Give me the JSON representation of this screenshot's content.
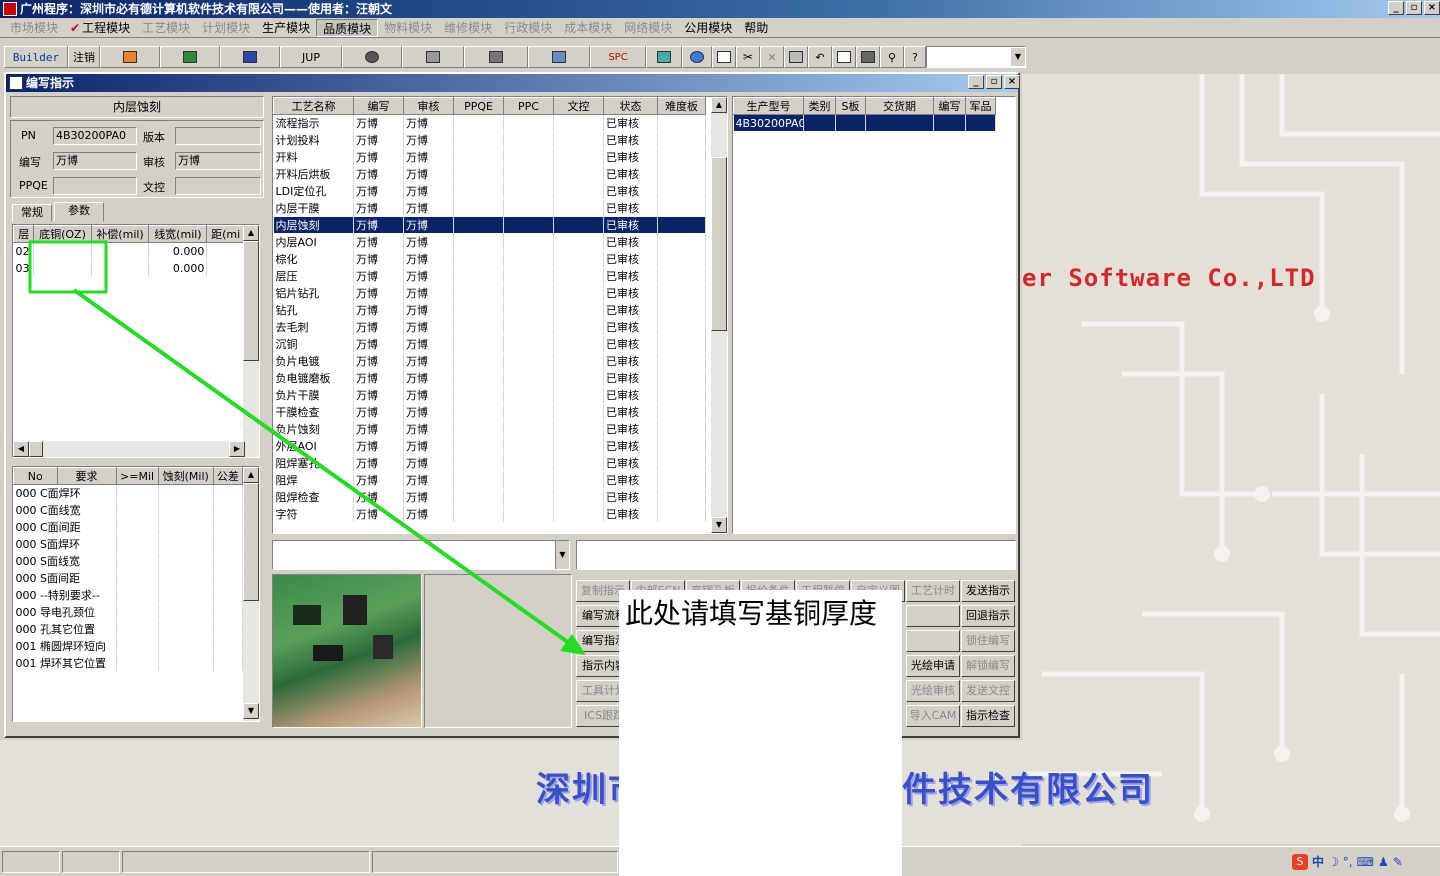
{
  "app": {
    "title": "广州程序：深圳市必有德计算机软件技术有限公司——使用者：汪朝文",
    "controls": [
      "_",
      "▫",
      "×"
    ]
  },
  "menus": [
    {
      "label": "市场模块",
      "enabled": false
    },
    {
      "label": "工程模块",
      "enabled": true,
      "checked": true
    },
    {
      "label": "工艺模块",
      "enabled": false
    },
    {
      "label": "计划模块",
      "enabled": false
    },
    {
      "label": "生产模块",
      "enabled": true
    },
    {
      "label": "品质模块",
      "enabled": true,
      "active": true
    },
    {
      "label": "物料模块",
      "enabled": false
    },
    {
      "label": "维修模块",
      "enabled": false
    },
    {
      "label": "行政模块",
      "enabled": false
    },
    {
      "label": "成本模块",
      "enabled": false
    },
    {
      "label": "网络模块",
      "enabled": false
    },
    {
      "label": "公用模块",
      "enabled": true
    },
    {
      "label": "帮助",
      "enabled": true
    }
  ],
  "toolbar": {
    "builder": "Builder",
    "logout": "注销",
    "jup": "JUP",
    "spc": "SPC"
  },
  "window": {
    "title": "编写指示",
    "controls": [
      "_",
      "▫",
      "×"
    ]
  },
  "process_name": "内层蚀刻",
  "form": {
    "pn_label": "PN",
    "pn": "4B30200PA0",
    "version_label": "版本",
    "version": "",
    "writer_label": "编写",
    "writer": "万博",
    "reviewer_label": "审核",
    "reviewer": "万博",
    "ppqe_label": "PPQE",
    "ppqe": "",
    "doc_label": "文控",
    "doc": ""
  },
  "tabs": {
    "normal": "常规",
    "params": "参数"
  },
  "layer_table": {
    "headers": [
      "层",
      "底铜(OZ)",
      "补偿(mil)",
      "线宽(mil)",
      "距(mi"
    ],
    "rows": [
      [
        "02",
        "",
        "",
        "0.000",
        ""
      ],
      [
        "03",
        "",
        "",
        "0.000",
        ""
      ]
    ]
  },
  "req_table": {
    "headers": [
      "No",
      "要求",
      ">=Mil",
      "蚀刻(Mil)",
      "公差"
    ],
    "rows": [
      [
        "000",
        "C面焊环"
      ],
      [
        "000",
        "C面线宽"
      ],
      [
        "000",
        "C面间距"
      ],
      [
        "000",
        "S面焊环"
      ],
      [
        "000",
        "S面线宽"
      ],
      [
        "000",
        "S面间距"
      ],
      [
        "000",
        "--特别要求--"
      ],
      [
        "000",
        "导电孔颈位"
      ],
      [
        "000",
        "孔其它位置"
      ],
      [
        "001",
        "椭圆焊环短向"
      ],
      [
        "001",
        "焊环其它位置"
      ]
    ]
  },
  "process_table": {
    "headers": [
      "工艺名称",
      "编写",
      "审核",
      "PPQE",
      "PPC",
      "文控",
      "状态",
      "难度板"
    ],
    "selected": 6,
    "rows": [
      [
        "流程指示",
        "万博",
        "万博",
        "",
        "",
        "",
        "已审核",
        ""
      ],
      [
        "计划投料",
        "万博",
        "万博",
        "",
        "",
        "",
        "已审核",
        ""
      ],
      [
        "开料",
        "万博",
        "万博",
        "",
        "",
        "",
        "已审核",
        ""
      ],
      [
        "开料后烘板",
        "万博",
        "万博",
        "",
        "",
        "",
        "已审核",
        ""
      ],
      [
        "LDI定位孔",
        "万博",
        "万博",
        "",
        "",
        "",
        "已审核",
        ""
      ],
      [
        "内层干膜",
        "万博",
        "万博",
        "",
        "",
        "",
        "已审核",
        ""
      ],
      [
        "内层蚀刻",
        "万博",
        "万博",
        "",
        "",
        "",
        "已审核",
        ""
      ],
      [
        "内层AOI",
        "万博",
        "万博",
        "",
        "",
        "",
        "已审核",
        ""
      ],
      [
        "棕化",
        "万博",
        "万博",
        "",
        "",
        "",
        "已审核",
        ""
      ],
      [
        "层压",
        "万博",
        "万博",
        "",
        "",
        "",
        "已审核",
        ""
      ],
      [
        "铝片钻孔",
        "万博",
        "万博",
        "",
        "",
        "",
        "已审核",
        ""
      ],
      [
        "钻孔",
        "万博",
        "万博",
        "",
        "",
        "",
        "已审核",
        ""
      ],
      [
        "去毛刺",
        "万博",
        "万博",
        "",
        "",
        "",
        "已审核",
        ""
      ],
      [
        "沉铜",
        "万博",
        "万博",
        "",
        "",
        "",
        "已审核",
        ""
      ],
      [
        "负片电镀",
        "万博",
        "万博",
        "",
        "",
        "",
        "已审核",
        ""
      ],
      [
        "负电镀磨板",
        "万博",
        "万博",
        "",
        "",
        "",
        "已审核",
        ""
      ],
      [
        "负片干膜",
        "万博",
        "万博",
        "",
        "",
        "",
        "已审核",
        ""
      ],
      [
        "干膜检查",
        "万博",
        "万博",
        "",
        "",
        "",
        "已审核",
        ""
      ],
      [
        "负片蚀刻",
        "万博",
        "万博",
        "",
        "",
        "",
        "已审核",
        ""
      ],
      [
        "外层AOI",
        "万博",
        "万博",
        "",
        "",
        "",
        "已审核",
        ""
      ],
      [
        "阻焊塞孔",
        "万博",
        "万博",
        "",
        "",
        "",
        "已审核",
        ""
      ],
      [
        "阻焊",
        "万博",
        "万博",
        "",
        "",
        "",
        "已审核",
        ""
      ],
      [
        "阻焊检查",
        "万博",
        "万博",
        "",
        "",
        "",
        "已审核",
        ""
      ],
      [
        "字符",
        "万博",
        "万博",
        "",
        "",
        "",
        "已审核",
        ""
      ]
    ]
  },
  "prod_table": {
    "headers": [
      "生产型号",
      "类别",
      "S板",
      "交货期",
      "编写",
      "军品"
    ],
    "rows": [
      [
        "4B30200PA0",
        "",
        "",
        "",
        "",
        ""
      ]
    ]
  },
  "buttons": {
    "row1": [
      {
        "label": "复制指示",
        "enabled": false
      },
      {
        "label": "内部ECN",
        "enabled": false
      },
      {
        "label": "高锣孔板",
        "enabled": false
      },
      {
        "label": "报价条件",
        "enabled": false
      },
      {
        "label": "工程暂停",
        "enabled": false
      },
      {
        "label": "自定义图",
        "enabled": false
      },
      {
        "label": "工艺计时",
        "enabled": false
      },
      {
        "label": "发送指示",
        "enabled": true
      }
    ],
    "left": [
      {
        "label": "编写流程",
        "enabled": true
      },
      {
        "label": "编写指示",
        "enabled": true
      },
      {
        "label": "指示内容",
        "enabled": true
      },
      {
        "label": "工具计划",
        "enabled": false
      },
      {
        "label": "ICS跟踪",
        "enabled": false
      }
    ],
    "right_a": [
      {
        "label": "",
        "enabled": false
      },
      {
        "label": "",
        "enabled": false
      },
      {
        "label": "光绘申请",
        "enabled": true
      },
      {
        "label": "光绘审核",
        "enabled": false
      },
      {
        "label": "导入CAM",
        "enabled": false
      }
    ],
    "right_b": [
      {
        "label": "回退指示",
        "enabled": true
      },
      {
        "label": "锁住编写",
        "enabled": false
      },
      {
        "label": "解锁编写",
        "enabled": false
      },
      {
        "label": "发送文控",
        "enabled": false
      },
      {
        "label": "指示检查",
        "enabled": true
      }
    ]
  },
  "annotation": {
    "text": "此处请填写基铜厚度",
    "color": "#22dd22"
  },
  "background": {
    "company_en": "er Software Co.,LTD",
    "company_cn": "深圳市必有德计算机软件技术有限公司",
    "company_cn_left": "深圳市",
    "company_cn_right": "件技术有限公司"
  },
  "tray": {
    "ime": "中"
  }
}
